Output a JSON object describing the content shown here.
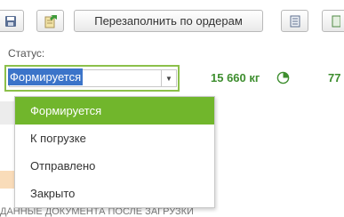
{
  "toolbar": {
    "refill_label": "Перезаполнить по ордерам",
    "icons": [
      "save-icon",
      "post-document-icon",
      "list-icon",
      "extra-icon"
    ]
  },
  "status": {
    "label": "Статус:",
    "value": "Формируется",
    "options": [
      "Формируется",
      "К погрузке",
      "Отправлено",
      "Закрыто"
    ]
  },
  "summary": {
    "weight": "15 660 кг",
    "count": "77"
  },
  "background": {
    "cut_text": "ДАННЫЕ ДОКУМЕНТА ПОСЛЕ ЗАГРУЗКИ"
  },
  "colors": {
    "accent_green": "#71b62c",
    "focus_border": "#8cc04a",
    "value_green": "#3e8e2f",
    "selection_blue": "#3b74c9"
  }
}
